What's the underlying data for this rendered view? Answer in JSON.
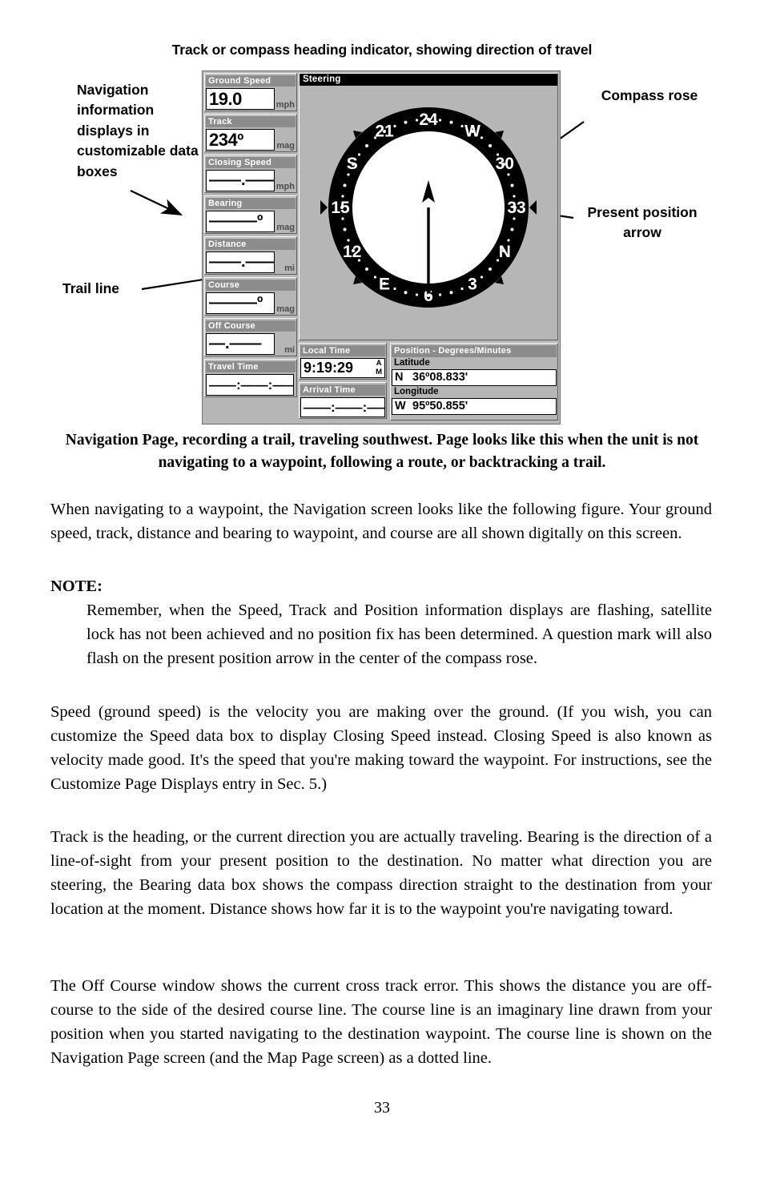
{
  "figure": {
    "title": "Track or compass heading indicator, showing direction of travel",
    "caption": "Navigation Page, recording a trail, traveling southwest. Page looks like this when the unit is not navigating to a waypoint, following a route, or backtracking a trail."
  },
  "callouts": {
    "data_boxes": "Navigation information displays in customizable data boxes",
    "trail_line": "Trail line",
    "compass_rose": "Compass rose",
    "present_position_arrow": "Present position arrow"
  },
  "gps_screen": {
    "steering_panel_title": "Steering",
    "left_boxes": [
      {
        "title": "Ground Speed",
        "value": "19.0",
        "unit": "mph",
        "dashes": false
      },
      {
        "title": "Track",
        "value": "234º",
        "unit": "mag",
        "dashes": false
      },
      {
        "title": "Closing Speed",
        "value": "——.——",
        "unit": "mph",
        "dashes": true
      },
      {
        "title": "Bearing",
        "value": "———º",
        "unit": "mag",
        "dashes": true
      },
      {
        "title": "Distance",
        "value": "——.——",
        "unit": "mi",
        "dashes": true
      },
      {
        "title": "Course",
        "value": "———º",
        "unit": "mag",
        "dashes": true
      },
      {
        "title": "Off Course",
        "value": "—.——",
        "unit": "mi",
        "dashes": true
      },
      {
        "title": "Travel Time",
        "value": "——:——:——",
        "unit": "",
        "dashes": true
      }
    ],
    "local_time": {
      "title": "Local Time",
      "value": "9:19:29",
      "meridiem_line1": "A",
      "meridiem_line2": "M"
    },
    "arrival_time": {
      "title": "Arrival Time",
      "value": "——:——:——"
    },
    "position": {
      "title": "Position - Degrees/Minutes",
      "latitude_label": "Latitude",
      "latitude_hemisphere": "N",
      "latitude_value": "36º08.833'",
      "longitude_label": "Longitude",
      "longitude_hemisphere": "W",
      "longitude_value": "95º50.855'"
    },
    "compass_rose": {
      "labels": [
        {
          "text": "24",
          "bearing": 0
        },
        {
          "text": "W",
          "bearing": 30
        },
        {
          "text": "30",
          "bearing": 60
        },
        {
          "text": "33",
          "bearing": 90
        },
        {
          "text": "N",
          "bearing": 120
        },
        {
          "text": "3",
          "bearing": 150
        },
        {
          "text": "6",
          "bearing": 180
        },
        {
          "text": "E",
          "bearing": 210
        },
        {
          "text": "12",
          "bearing": 240
        },
        {
          "text": "15",
          "bearing": 270
        },
        {
          "text": "S",
          "bearing": 300
        },
        {
          "text": "21",
          "bearing": 330
        }
      ],
      "heading_marker_bearing": 0,
      "present_position_arrow_direction": "up"
    }
  },
  "body": {
    "paragraph_1": "When navigating to a waypoint, the Navigation screen looks like the following figure. Your ground speed, track, distance and bearing to waypoint, and course are all shown digitally on this screen.",
    "note_label": "NOTE:",
    "note_text": "Remember, when the Speed, Track and Position information displays are flashing, satellite lock has not been achieved and no position fix has been determined. A question mark will also flash on the present position arrow in the center of the compass rose.",
    "paragraph_2": "Speed (ground speed) is the velocity you are making over the ground. (If you wish, you can customize the Speed data box to display Closing Speed instead. Closing Speed is also known as velocity made good. It's the speed that you're making toward the waypoint. For instructions, see the Customize Page Displays entry in Sec. 5.)",
    "paragraph_3": "Track is the heading, or the current direction you are actually traveling. Bearing is the direction of a line-of-sight from your present position to the destination. No matter what direction you are steering, the Bearing data box shows the compass direction straight to the destination from your location at the moment. Distance shows how far it is to the waypoint you're navigating toward.",
    "paragraph_4": "The Off Course window shows the current cross track error. This shows the distance you are off-course to the side of the desired course line. The course line is an imaginary line drawn from your position when you started navigating to the destination waypoint. The course line is shown on the Navigation Page screen (and the Map Page screen) as a dotted line."
  },
  "page_number": "33",
  "colors": {
    "screen_background": "#b6b6b6",
    "title_bar": "#8c8c8c",
    "steering_bar": "#000000",
    "value_background": "#ffffff"
  }
}
